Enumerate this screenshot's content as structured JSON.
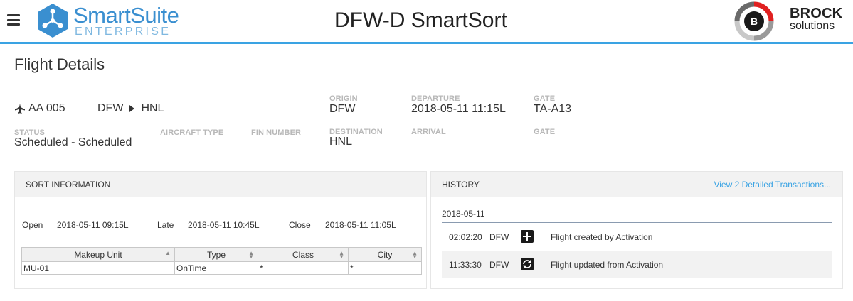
{
  "header": {
    "logo_title": "SmartSuite",
    "logo_sub": "ENTERPRISE",
    "app_title": "DFW-D SmartSort",
    "brand_name": "BROCK",
    "brand_sub": "solutions",
    "accent_color": "#3aa3e3"
  },
  "page": {
    "title": "Flight Details"
  },
  "flight": {
    "number": "AA 005",
    "route_from": "DFW",
    "route_to": "HNL",
    "origin_label": "ORIGIN",
    "origin": "DFW",
    "departure_label": "DEPARTURE",
    "departure": "2018-05-11 11:15L",
    "gate_label": "GATE",
    "gate": "TA-A13",
    "status_label": "STATUS",
    "status": "Scheduled - Scheduled",
    "aircraft_label": "AIRCRAFT TYPE",
    "fin_label": "FIN NUMBER",
    "destination_label": "DESTINATION",
    "destination": "HNL",
    "arrival_label": "ARRIVAL",
    "gate2_label": "GATE"
  },
  "sort_info": {
    "title": "SORT INFORMATION",
    "open_label": "Open",
    "open": "2018-05-11 09:15L",
    "late_label": "Late",
    "late": "2018-05-11 10:45L",
    "close_label": "Close",
    "close": "2018-05-11 11:05L",
    "columns": [
      "Makeup Unit",
      "Type",
      "Class",
      "City"
    ],
    "rows": [
      [
        "MU-01",
        "OnTime",
        "*",
        "*"
      ]
    ]
  },
  "history": {
    "title": "HISTORY",
    "link": "View 2 Detailed Transactions...",
    "date": "2018-05-11",
    "entries": [
      {
        "time": "02:02:20",
        "station": "DFW",
        "icon": "plus-icon",
        "desc": "Flight created by Activation"
      },
      {
        "time": "11:33:30",
        "station": "DFW",
        "icon": "refresh-icon",
        "desc": "Flight updated from Activation"
      }
    ]
  }
}
